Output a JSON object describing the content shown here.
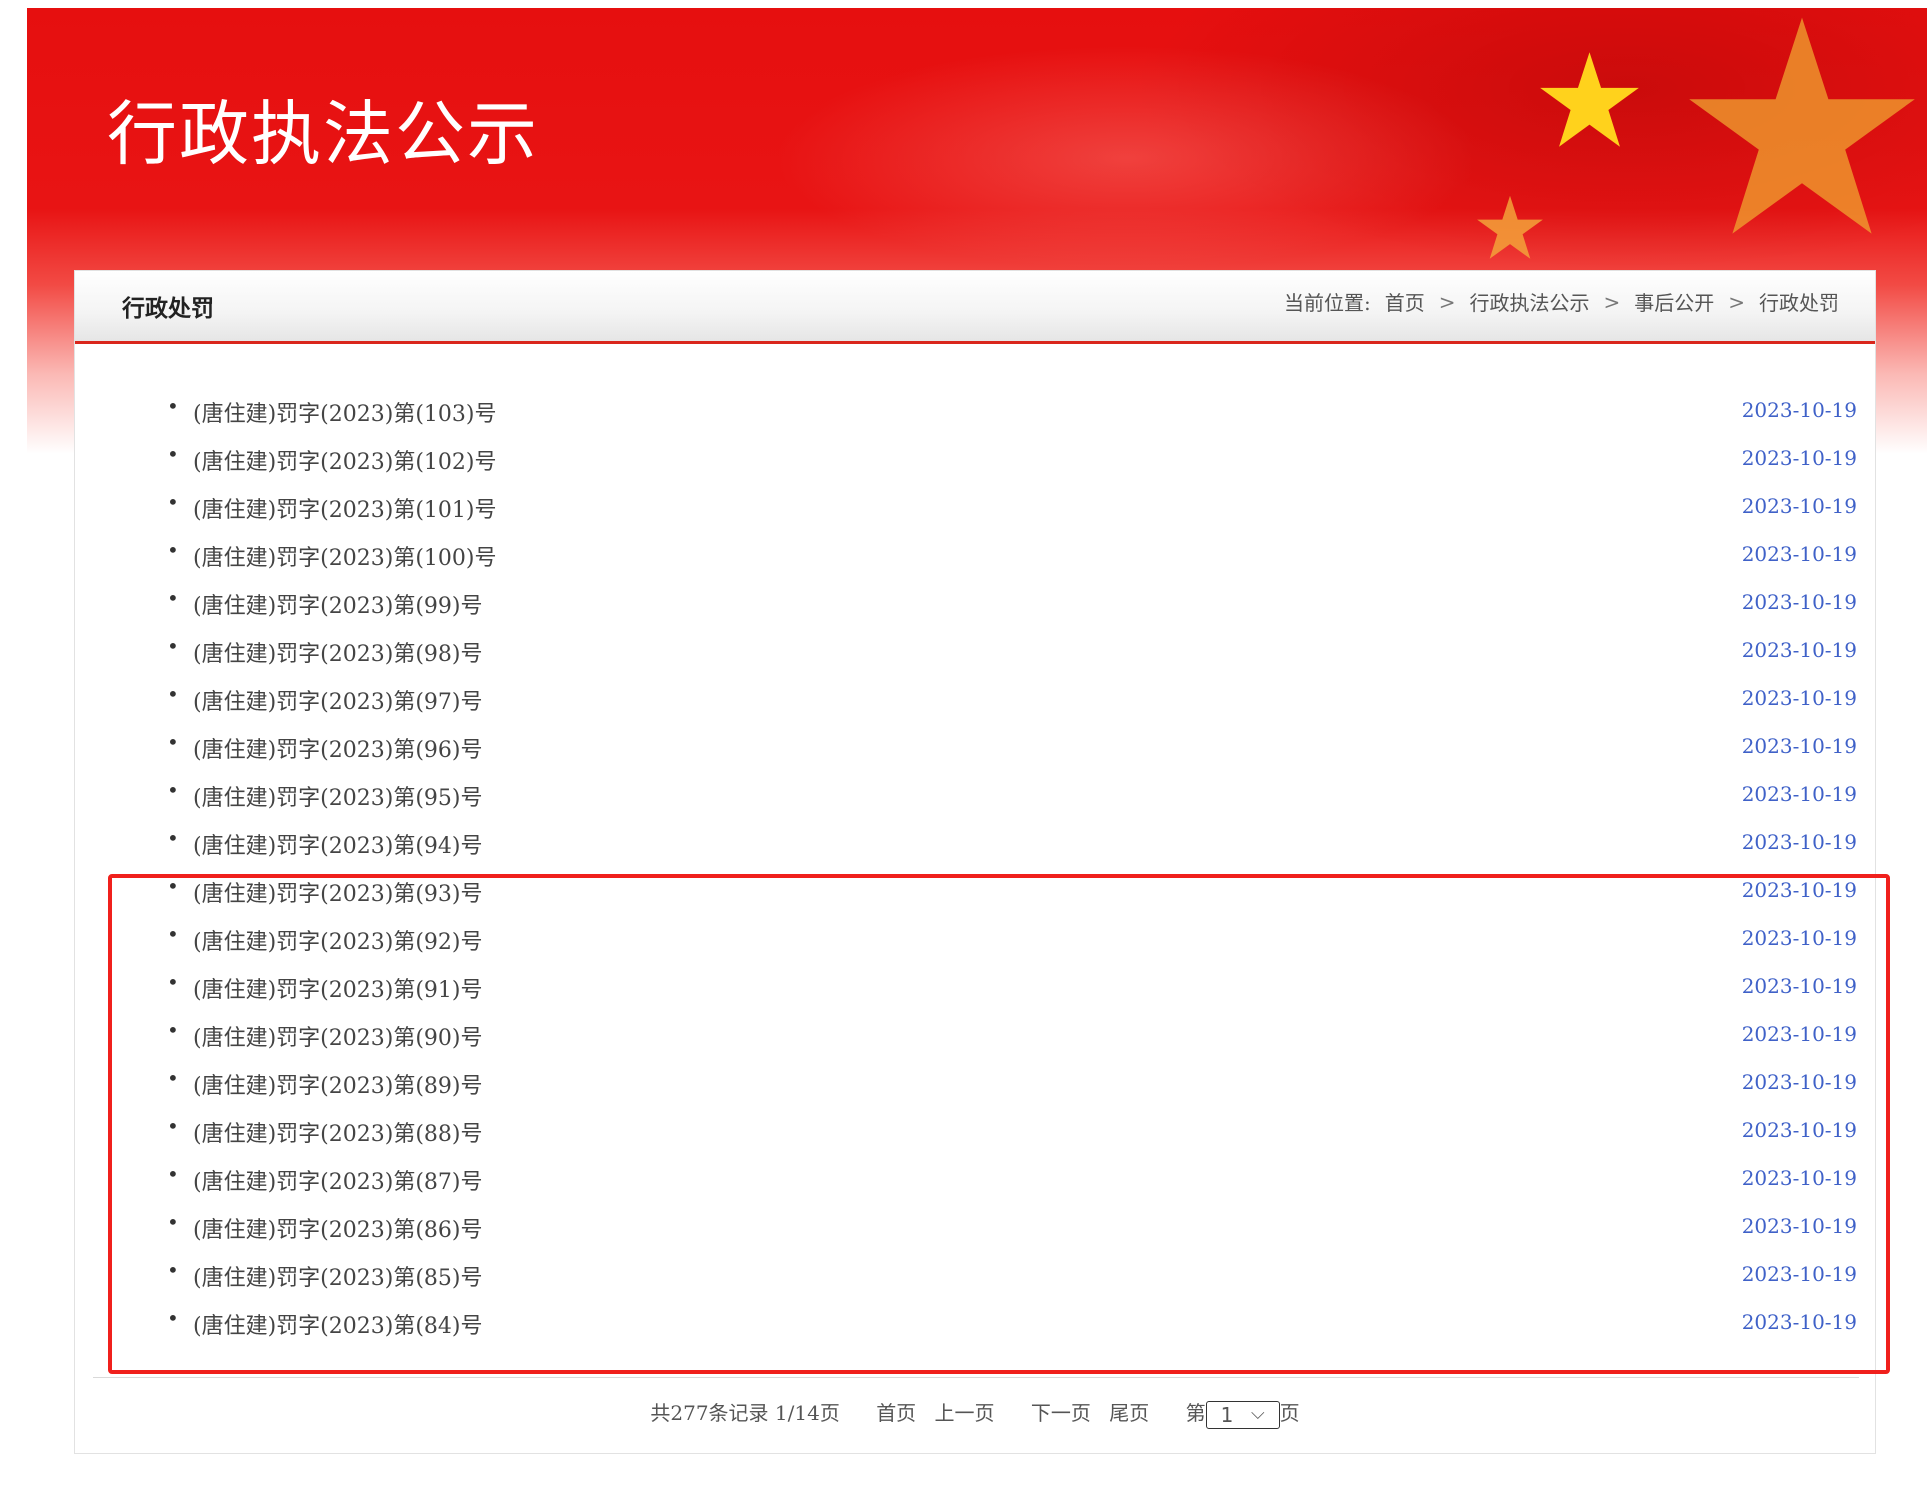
{
  "banner": {
    "site_title": "行政执法公示"
  },
  "panel": {
    "title": "行政处罚"
  },
  "breadcrumb": {
    "label": "当前位置:",
    "items": [
      "首页",
      "行政执法公示",
      "事后公开",
      "行政处罚"
    ],
    "separator": ">"
  },
  "list": {
    "bullet": "•",
    "items": [
      {
        "title": "(唐住建)罚字(2023)第(103)号",
        "date": "2023-10-19"
      },
      {
        "title": "(唐住建)罚字(2023)第(102)号",
        "date": "2023-10-19"
      },
      {
        "title": "(唐住建)罚字(2023)第(101)号",
        "date": "2023-10-19"
      },
      {
        "title": "(唐住建)罚字(2023)第(100)号",
        "date": "2023-10-19"
      },
      {
        "title": "(唐住建)罚字(2023)第(99)号",
        "date": "2023-10-19"
      },
      {
        "title": "(唐住建)罚字(2023)第(98)号",
        "date": "2023-10-19"
      },
      {
        "title": "(唐住建)罚字(2023)第(97)号",
        "date": "2023-10-19"
      },
      {
        "title": "(唐住建)罚字(2023)第(96)号",
        "date": "2023-10-19"
      },
      {
        "title": "(唐住建)罚字(2023)第(95)号",
        "date": "2023-10-19"
      },
      {
        "title": "(唐住建)罚字(2023)第(94)号",
        "date": "2023-10-19"
      },
      {
        "title": "(唐住建)罚字(2023)第(93)号",
        "date": "2023-10-19"
      },
      {
        "title": "(唐住建)罚字(2023)第(92)号",
        "date": "2023-10-19"
      },
      {
        "title": "(唐住建)罚字(2023)第(91)号",
        "date": "2023-10-19"
      },
      {
        "title": "(唐住建)罚字(2023)第(90)号",
        "date": "2023-10-19"
      },
      {
        "title": "(唐住建)罚字(2023)第(89)号",
        "date": "2023-10-19"
      },
      {
        "title": "(唐住建)罚字(2023)第(88)号",
        "date": "2023-10-19"
      },
      {
        "title": "(唐住建)罚字(2023)第(87)号",
        "date": "2023-10-19"
      },
      {
        "title": "(唐住建)罚字(2023)第(86)号",
        "date": "2023-10-19"
      },
      {
        "title": "(唐住建)罚字(2023)第(85)号",
        "date": "2023-10-19"
      },
      {
        "title": "(唐住建)罚字(2023)第(84)号",
        "date": "2023-10-19"
      }
    ]
  },
  "pager": {
    "summary": "共277条记录 1/14页",
    "first": "首页",
    "prev": "上一页",
    "next": "下一页",
    "last": "尾页",
    "goto_prefix": "第",
    "current_page": "1",
    "goto_suffix": "页"
  },
  "colors": {
    "banner_red": "#e60f0f",
    "accent_line": "#d9261c",
    "date_blue": "#3f61c8",
    "highlight_red": "#f0201c"
  }
}
